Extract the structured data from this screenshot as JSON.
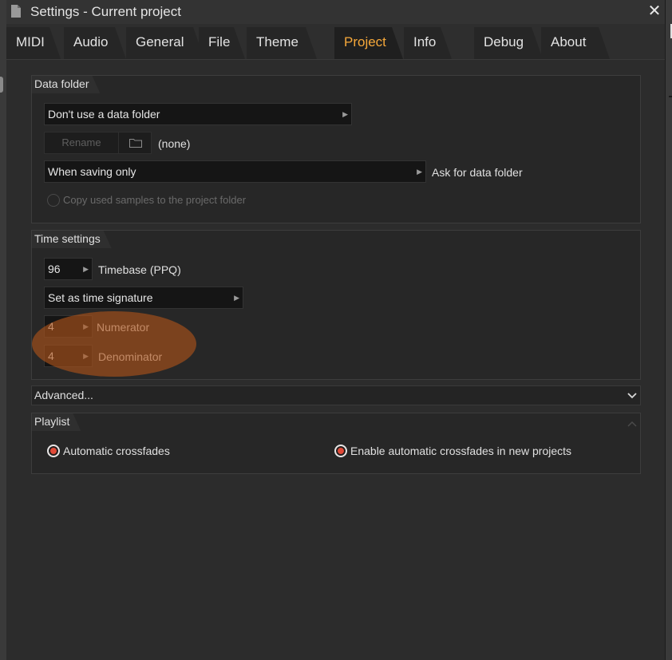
{
  "window": {
    "title": "Settings - Current project",
    "close_symbol": "✕"
  },
  "tabs": [
    {
      "label": "MIDI"
    },
    {
      "label": "Audio"
    },
    {
      "label": "General"
    },
    {
      "label": "File"
    },
    {
      "label": "Theme"
    },
    {
      "label": "Project",
      "active": true
    },
    {
      "label": "Info"
    },
    {
      "label": "Debug"
    },
    {
      "label": "About"
    }
  ],
  "data_folder": {
    "header": "Data folder",
    "mode_value": "Don't use a data folder",
    "rename_label": "Rename",
    "folder_path": "(none)",
    "when_value": "When saving only",
    "when_label": "Ask for data folder",
    "copy_samples_label": "Copy used samples to the project folder",
    "copy_samples_enabled": false
  },
  "time_settings": {
    "header": "Time settings",
    "timebase_value": "96",
    "timebase_label": "Timebase (PPQ)",
    "signature_value": "Set as time signature",
    "numerator_value": "4",
    "numerator_label": "Numerator",
    "denominator_value": "4",
    "denominator_label": "Denominator"
  },
  "advanced": {
    "label": "Advanced..."
  },
  "playlist": {
    "header": "Playlist",
    "auto_crossfades_label": "Automatic crossfades",
    "auto_crossfades_checked": true,
    "new_project_crossfades_label": "Enable automatic crossfades in new projects",
    "new_project_crossfades_checked": true
  },
  "colors": {
    "accent_tab": "#f6a83a",
    "radio_on": "#e14a38",
    "highlight": "#b0541a"
  },
  "icons": {
    "window": "document-icon",
    "folder": "folder-icon",
    "dropdown": "triangle-right-icon",
    "expand": "chevron-down-icon",
    "collapse": "chevron-up-icon"
  }
}
